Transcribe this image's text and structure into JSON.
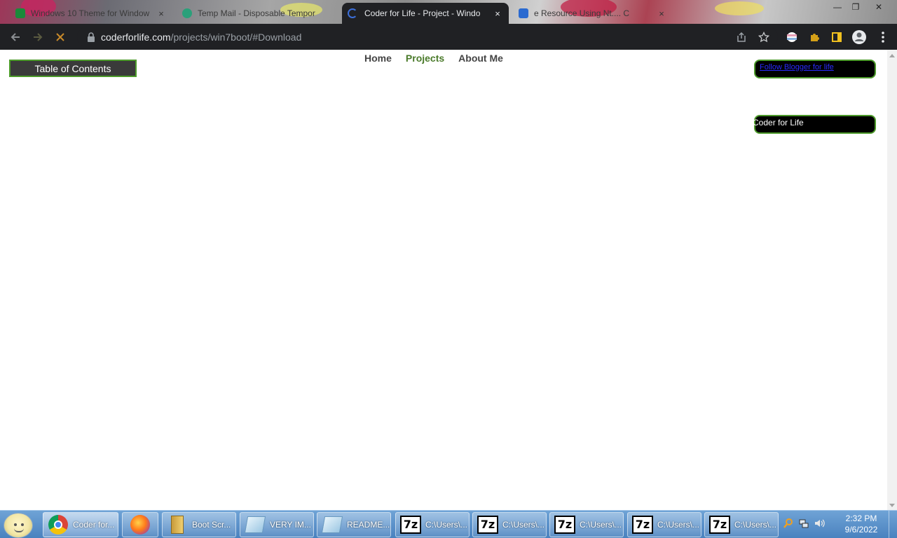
{
  "browser": {
    "tabs": [
      {
        "title": "Windows 10 Theme for Window",
        "close": "×",
        "favicon": "green-bolt-icon"
      },
      {
        "title": "Temp Mail - Disposable Tempor",
        "close": "",
        "favicon": "temp-mail-icon"
      },
      {
        "title": "Coder for Life - Project - Windo",
        "close": "×",
        "favicon": "loading-spinner-icon",
        "active": true
      },
      {
        "title": "e Resource Using Nt.... C",
        "close": "×",
        "favicon": "blue-app-icon"
      }
    ],
    "window_controls": {
      "minimize": "—",
      "restore": "❐",
      "close": "✕"
    },
    "url_host": "coderforlife.com",
    "url_path": "/projects/win7boot/#Download",
    "toolbar_icons": [
      "back-arrow-icon",
      "forward-arrow-icon",
      "stop-loading-icon",
      "lock-icon",
      "share-icon",
      "star-icon",
      "profile-flag-icon",
      "extensions-puzzle-icon",
      "side-panel-icon",
      "account-icon",
      "menu-dots-icon"
    ]
  },
  "page": {
    "toc_label": "Table of Contents",
    "nav": [
      {
        "label": "Home"
      },
      {
        "label": "Projects",
        "current": true
      },
      {
        "label": "About Me"
      }
    ],
    "follow_link": "Follow Blogger for life",
    "coder_for_life": "Coder for Life"
  },
  "taskbar": {
    "items": [
      {
        "label": "Coder for...",
        "icon": "chrome-icon"
      },
      {
        "label": "",
        "icon": "firefox-icon"
      },
      {
        "label": "Boot Scr...",
        "icon": "folder-icon"
      },
      {
        "label": "VERY IM...",
        "icon": "notepad-icon"
      },
      {
        "label": "README....",
        "icon": "notepad-icon"
      },
      {
        "label": "C:\\Users\\...",
        "icon": "7zip-icon"
      },
      {
        "label": "C:\\Users\\...",
        "icon": "7zip-icon"
      },
      {
        "label": "C:\\Users\\...",
        "icon": "7zip-icon"
      },
      {
        "label": "C:\\Users\\...",
        "icon": "7zip-icon"
      },
      {
        "label": "C:\\Users\\...",
        "icon": "7zip-icon"
      }
    ],
    "sevenzip_glyph": "7z",
    "clock_time": "2:32 PM",
    "clock_date": "9/6/2022"
  },
  "colors": {
    "tab_active_bg": "#202124",
    "toc_bg": "#3a3a3a",
    "accent_green": "#4c9a2a",
    "nav_current": "#4a7a2a",
    "taskbar": "#5a91cb"
  }
}
